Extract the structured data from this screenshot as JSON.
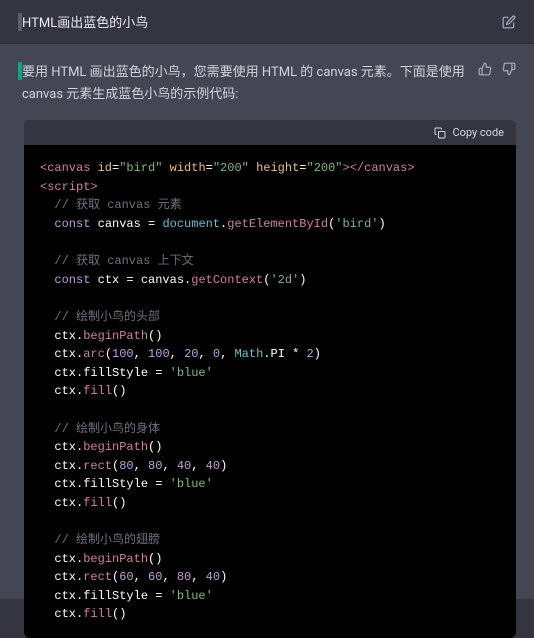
{
  "user": {
    "text": "HTML画出蓝色的小鸟"
  },
  "assistant": {
    "text": "要用 HTML 画出蓝色的小鸟，您需要使用 HTML 的 canvas 元素。下面是使用 canvas 元素生成蓝色小鸟的示例代码:"
  },
  "codeblock": {
    "copy_label": "Copy code",
    "lines": [
      {
        "tokens": [
          {
            "t": "<canvas ",
            "c": "c-tag"
          },
          {
            "t": "id",
            "c": "c-attr"
          },
          {
            "t": "=",
            "c": "c-white"
          },
          {
            "t": "\"bird\"",
            "c": "c-str"
          },
          {
            "t": " ",
            "c": "c-white"
          },
          {
            "t": "width",
            "c": "c-attr"
          },
          {
            "t": "=",
            "c": "c-white"
          },
          {
            "t": "\"200\"",
            "c": "c-str"
          },
          {
            "t": " ",
            "c": "c-white"
          },
          {
            "t": "height",
            "c": "c-attr"
          },
          {
            "t": "=",
            "c": "c-white"
          },
          {
            "t": "\"200\"",
            "c": "c-str"
          },
          {
            "t": "></canvas>",
            "c": "c-tag"
          }
        ]
      },
      {
        "tokens": [
          {
            "t": "<script>",
            "c": "c-tag"
          }
        ]
      },
      {
        "tokens": [
          {
            "t": "  // 获取 canvas 元素",
            "c": "c-cmt"
          }
        ]
      },
      {
        "tokens": [
          {
            "t": "  ",
            "c": "c-white"
          },
          {
            "t": "const",
            "c": "c-kw"
          },
          {
            "t": " canvas = ",
            "c": "c-white"
          },
          {
            "t": "document",
            "c": "c-obj"
          },
          {
            "t": ".",
            "c": "c-white"
          },
          {
            "t": "getElementById",
            "c": "c-fn"
          },
          {
            "t": "(",
            "c": "c-white"
          },
          {
            "t": "'bird'",
            "c": "c-str"
          },
          {
            "t": ")",
            "c": "c-white"
          }
        ]
      },
      {
        "tokens": [
          {
            "t": " ",
            "c": "c-white"
          }
        ]
      },
      {
        "tokens": [
          {
            "t": "  // 获取 canvas 上下文",
            "c": "c-cmt"
          }
        ]
      },
      {
        "tokens": [
          {
            "t": "  ",
            "c": "c-white"
          },
          {
            "t": "const",
            "c": "c-kw"
          },
          {
            "t": " ctx = canvas.",
            "c": "c-white"
          },
          {
            "t": "getContext",
            "c": "c-fn"
          },
          {
            "t": "(",
            "c": "c-white"
          },
          {
            "t": "'2d'",
            "c": "c-str"
          },
          {
            "t": ")",
            "c": "c-white"
          }
        ]
      },
      {
        "tokens": [
          {
            "t": " ",
            "c": "c-white"
          }
        ]
      },
      {
        "tokens": [
          {
            "t": "  // 绘制小鸟的头部",
            "c": "c-cmt"
          }
        ]
      },
      {
        "tokens": [
          {
            "t": "  ctx.",
            "c": "c-white"
          },
          {
            "t": "beginPath",
            "c": "c-fn"
          },
          {
            "t": "()",
            "c": "c-white"
          }
        ]
      },
      {
        "tokens": [
          {
            "t": "  ctx.",
            "c": "c-white"
          },
          {
            "t": "arc",
            "c": "c-fn"
          },
          {
            "t": "(",
            "c": "c-white"
          },
          {
            "t": "100",
            "c": "c-num"
          },
          {
            "t": ", ",
            "c": "c-white"
          },
          {
            "t": "100",
            "c": "c-num"
          },
          {
            "t": ", ",
            "c": "c-white"
          },
          {
            "t": "20",
            "c": "c-num"
          },
          {
            "t": ", ",
            "c": "c-white"
          },
          {
            "t": "0",
            "c": "c-num"
          },
          {
            "t": ", ",
            "c": "c-white"
          },
          {
            "t": "Math",
            "c": "c-obj"
          },
          {
            "t": ".PI * ",
            "c": "c-white"
          },
          {
            "t": "2",
            "c": "c-num"
          },
          {
            "t": ")",
            "c": "c-white"
          }
        ]
      },
      {
        "tokens": [
          {
            "t": "  ctx.fillStyle = ",
            "c": "c-white"
          },
          {
            "t": "'blue'",
            "c": "c-str"
          }
        ]
      },
      {
        "tokens": [
          {
            "t": "  ctx.",
            "c": "c-white"
          },
          {
            "t": "fill",
            "c": "c-fn"
          },
          {
            "t": "()",
            "c": "c-white"
          }
        ]
      },
      {
        "tokens": [
          {
            "t": " ",
            "c": "c-white"
          }
        ]
      },
      {
        "tokens": [
          {
            "t": "  // 绘制小鸟的身体",
            "c": "c-cmt"
          }
        ]
      },
      {
        "tokens": [
          {
            "t": "  ctx.",
            "c": "c-white"
          },
          {
            "t": "beginPath",
            "c": "c-fn"
          },
          {
            "t": "()",
            "c": "c-white"
          }
        ]
      },
      {
        "tokens": [
          {
            "t": "  ctx.",
            "c": "c-white"
          },
          {
            "t": "rect",
            "c": "c-fn"
          },
          {
            "t": "(",
            "c": "c-white"
          },
          {
            "t": "80",
            "c": "c-num"
          },
          {
            "t": ", ",
            "c": "c-white"
          },
          {
            "t": "80",
            "c": "c-num"
          },
          {
            "t": ", ",
            "c": "c-white"
          },
          {
            "t": "40",
            "c": "c-num"
          },
          {
            "t": ", ",
            "c": "c-white"
          },
          {
            "t": "40",
            "c": "c-num"
          },
          {
            "t": ")",
            "c": "c-white"
          }
        ]
      },
      {
        "tokens": [
          {
            "t": "  ctx.fillStyle = ",
            "c": "c-white"
          },
          {
            "t": "'blue'",
            "c": "c-str"
          }
        ]
      },
      {
        "tokens": [
          {
            "t": "  ctx.",
            "c": "c-white"
          },
          {
            "t": "fill",
            "c": "c-fn"
          },
          {
            "t": "()",
            "c": "c-white"
          }
        ]
      },
      {
        "tokens": [
          {
            "t": " ",
            "c": "c-white"
          }
        ]
      },
      {
        "tokens": [
          {
            "t": "  // 绘制小鸟的翅膀",
            "c": "c-cmt"
          }
        ]
      },
      {
        "tokens": [
          {
            "t": "  ctx.",
            "c": "c-white"
          },
          {
            "t": "beginPath",
            "c": "c-fn"
          },
          {
            "t": "()",
            "c": "c-white"
          }
        ]
      },
      {
        "tokens": [
          {
            "t": "  ctx.",
            "c": "c-white"
          },
          {
            "t": "rect",
            "c": "c-fn"
          },
          {
            "t": "(",
            "c": "c-white"
          },
          {
            "t": "60",
            "c": "c-num"
          },
          {
            "t": ", ",
            "c": "c-white"
          },
          {
            "t": "60",
            "c": "c-num"
          },
          {
            "t": ", ",
            "c": "c-white"
          },
          {
            "t": "80",
            "c": "c-num"
          },
          {
            "t": ", ",
            "c": "c-white"
          },
          {
            "t": "40",
            "c": "c-num"
          },
          {
            "t": ")",
            "c": "c-white"
          }
        ]
      },
      {
        "tokens": [
          {
            "t": "  ctx.fillStyle = ",
            "c": "c-white"
          },
          {
            "t": "'blue'",
            "c": "c-str"
          }
        ]
      },
      {
        "tokens": [
          {
            "t": "  ctx.",
            "c": "c-white"
          },
          {
            "t": "fill",
            "c": "c-fn"
          },
          {
            "t": "()",
            "c": "c-white"
          }
        ]
      }
    ]
  },
  "icons": {
    "edit": "edit-icon",
    "thumbs_up": "thumbs-up-icon",
    "thumbs_down": "thumbs-down-icon",
    "copy": "clipboard-icon"
  }
}
